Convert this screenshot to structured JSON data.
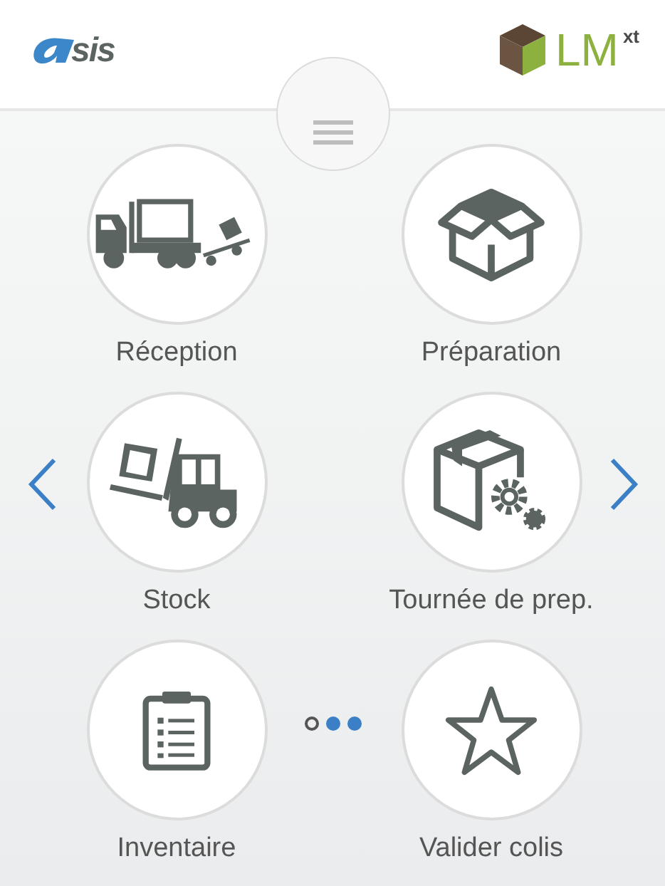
{
  "header": {
    "brand_left": "sis",
    "brand_right": "LM",
    "brand_right_sup": "xt"
  },
  "tiles": [
    {
      "label": "Réception",
      "kind": "truck"
    },
    {
      "label": "Préparation",
      "kind": "box"
    },
    {
      "label": "Stock",
      "kind": "forklift"
    },
    {
      "label": "Tournée de prep.",
      "kind": "boxgear"
    },
    {
      "label": "Inventaire",
      "kind": "clipboard"
    },
    {
      "label": "Valider colis",
      "kind": "star"
    }
  ],
  "pager": [
    {
      "selected": true
    },
    {
      "selected": false
    },
    {
      "selected": false
    }
  ]
}
